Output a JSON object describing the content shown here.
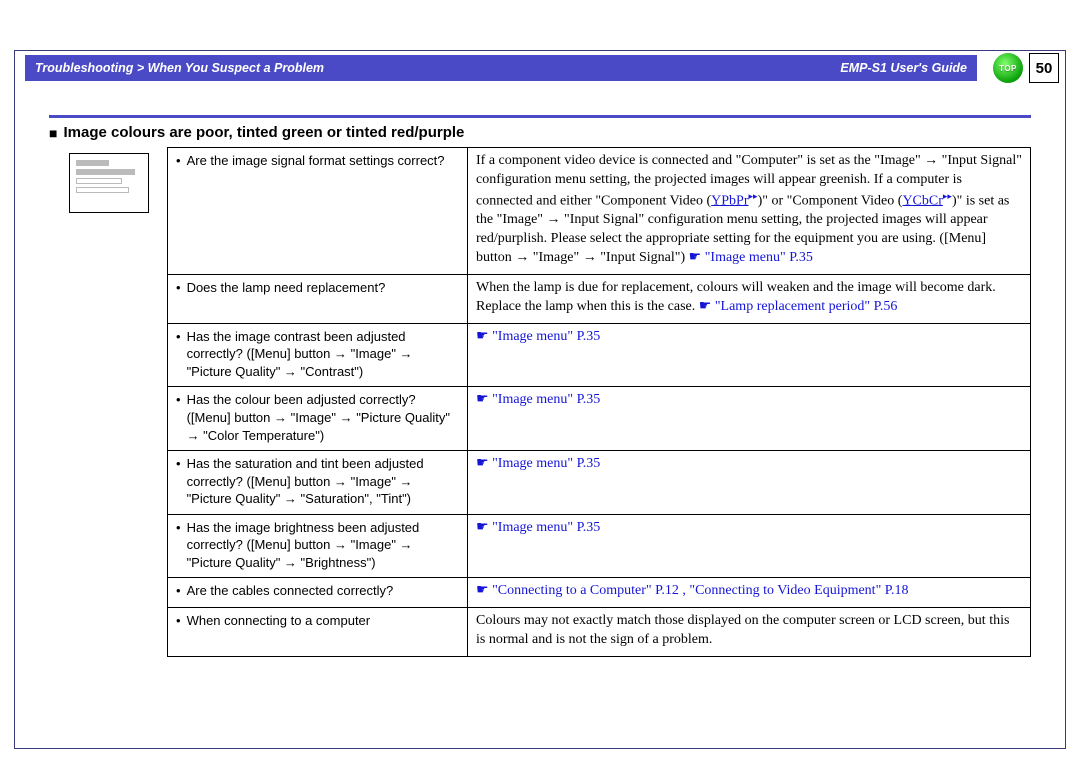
{
  "header": {
    "breadcrumb": "Troubleshooting > When You Suspect a Problem",
    "guide": "EMP-S1 User's Guide",
    "top_label": "TOP",
    "page_number": "50"
  },
  "section": {
    "title": "Image colours are poor, tinted green or tinted red/purple"
  },
  "rows": [
    {
      "question": "Are the image signal format settings correct?",
      "answer_pre": "If a component video device is connected and \"Computer\" is set as the \"Image\" → \"Input Signal\" configuration menu setting, the projected images will appear greenish. If a computer is connected and either \"Component Video (",
      "link1": "YPbPr",
      "answer_mid1": ")\" or \"Component Video (",
      "link2": "YCbCr",
      "answer_mid2": ")\" is set as the \"Image\" → \"Input Signal\" configuration menu setting, the projected images will appear red/purplish. Please select the appropriate setting for the equipment you are using. ([Menu] button → \"Image\" → \"Input Signal\") ",
      "ref": "\"Image menu\" P.35"
    },
    {
      "question": "Does the lamp need replacement?",
      "answer_pre": "When the lamp is due for replacement, colours will weaken and the image will become dark. Replace the lamp when this is the case. ",
      "ref": "\"Lamp replacement period\" P.56"
    },
    {
      "question": "Has the image contrast been adjusted correctly? ([Menu] button → \"Image\" → \"Picture Quality\" → \"Contrast\")",
      "ref": "\"Image menu\" P.35"
    },
    {
      "question": "Has the colour been adjusted correctly? ([Menu] button → \"Image\" → \"Picture Quality\" → \"Color Temperature\")",
      "ref": "\"Image menu\" P.35"
    },
    {
      "question": "Has the saturation and tint been adjusted correctly? ([Menu] button → \"Image\" → \"Picture Quality\" → \"Saturation\", \"Tint\")",
      "ref": "\"Image menu\" P.35"
    },
    {
      "question": "Has the image brightness been adjusted correctly? ([Menu] button → \"Image\" → \"Picture Quality\" → \"Brightness\")",
      "ref": "\"Image menu\" P.35"
    },
    {
      "question": "Are the cables connected correctly?",
      "ref": "\"Connecting to a Computer\" P.12 , \"Connecting to Video Equipment\" P.18"
    },
    {
      "question": "When connecting to a computer",
      "answer_pre": "Colours may not exactly match those displayed on the computer screen or LCD screen, but this is normal and is not the sign of a problem."
    }
  ]
}
